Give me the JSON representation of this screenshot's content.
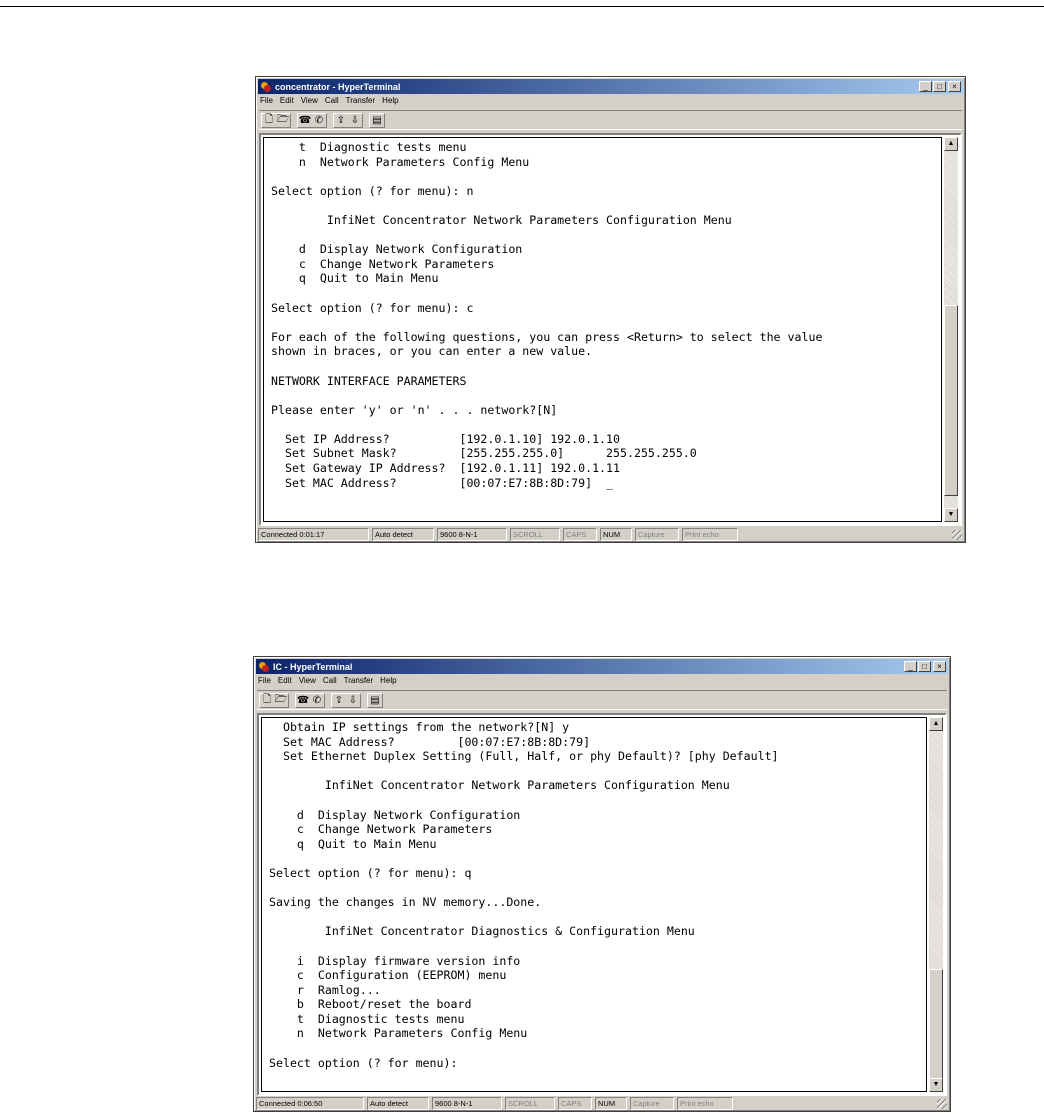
{
  "window1": {
    "title": "concentrator - HyperTerminal",
    "menu": [
      "File",
      "Edit",
      "View",
      "Call",
      "Transfer",
      "Help"
    ],
    "terminal_lines": [
      "    t  Diagnostic tests menu",
      "    n  Network Parameters Config Menu",
      "",
      "Select option (? for menu): n",
      "",
      "        InfiNet Concentrator Network Parameters Configuration Menu",
      "",
      "    d  Display Network Configuration",
      "    c  Change Network Parameters",
      "    q  Quit to Main Menu",
      "",
      "Select option (? for menu): c",
      "",
      "For each of the following questions, you can press <Return> to select the value",
      "shown in braces, or you can enter a new value.",
      "",
      "NETWORK INTERFACE PARAMETERS",
      "",
      "Please enter 'y' or 'n' . . . network?[N]",
      "",
      "  Set IP Address?          [192.0.1.10] 192.0.1.10",
      "  Set Subnet Mask?         [255.255.255.0]      255.255.255.0",
      "  Set Gateway IP Address?  [192.0.1.11] 192.0.1.11",
      "  Set MAC Address?         [00:07:E7:8B:8D:79]  _"
    ],
    "status": {
      "connected": "Connected 0:01:17",
      "detect": "Auto detect",
      "settings": "9600 8-N-1",
      "scroll": "SCROLL",
      "caps": "CAPS",
      "num": "NUM",
      "capture": "Capture",
      "print_echo": "Print echo"
    }
  },
  "window2": {
    "title": "IC - HyperTerminal",
    "menu": [
      "File",
      "Edit",
      "View",
      "Call",
      "Transfer",
      "Help"
    ],
    "terminal_lines": [
      "  Obtain IP settings from the network?[N] y",
      "  Set MAC Address?         [00:07:E7:8B:8D:79]",
      "  Set Ethernet Duplex Setting (Full, Half, or phy Default)? [phy Default]",
      "",
      "        InfiNet Concentrator Network Parameters Configuration Menu",
      "",
      "    d  Display Network Configuration",
      "    c  Change Network Parameters",
      "    q  Quit to Main Menu",
      "",
      "Select option (? for menu): q",
      "",
      "Saving the changes in NV memory...Done.",
      "",
      "        InfiNet Concentrator Diagnostics & Configuration Menu",
      "",
      "    i  Display firmware version info",
      "    c  Configuration (EEPROM) menu",
      "    r  Ramlog...",
      "    b  Reboot/reset the board",
      "    t  Diagnostic tests menu",
      "    n  Network Parameters Config Menu",
      "",
      "Select option (? for menu):"
    ],
    "status": {
      "connected": "Connected 0:06:50",
      "detect": "Auto detect",
      "settings": "9600 8-N-1",
      "scroll": "SCROLL",
      "caps": "CAPS",
      "num": "NUM",
      "capture": "Capture",
      "print_echo": "Print echo"
    }
  },
  "icons": {
    "new": "new-document-icon",
    "open": "open-folder-icon",
    "call": "call-phone-icon",
    "disconnect": "disconnect-icon",
    "send": "send-file-icon",
    "receive": "receive-file-icon",
    "properties": "properties-icon"
  }
}
